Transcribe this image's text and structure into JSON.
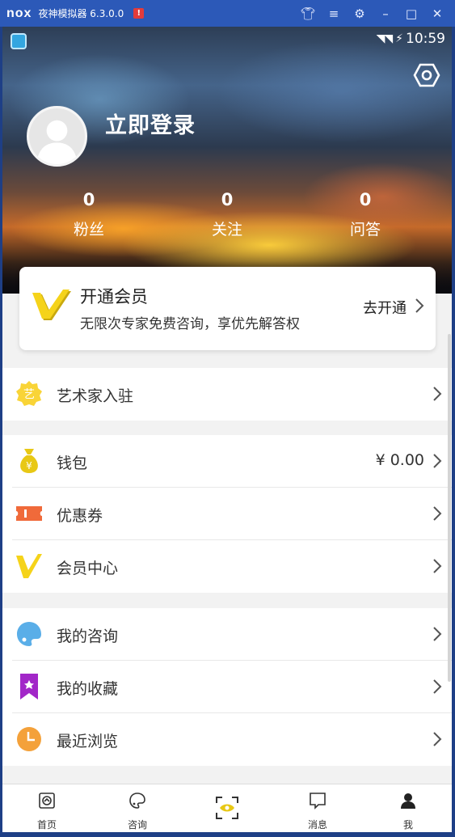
{
  "emulator": {
    "logo": "nox",
    "title": "夜神模拟器 6.3.0.0",
    "alert": "!"
  },
  "status_bar": {
    "time": "10:59"
  },
  "profile": {
    "login_text": "立即登录"
  },
  "stats": [
    {
      "value": "0",
      "label": "粉丝"
    },
    {
      "value": "0",
      "label": "关注"
    },
    {
      "value": "0",
      "label": "问答"
    }
  ],
  "member_card": {
    "title": "开通会员",
    "subtitle": "无限次专家免费咨询，享优先解答权",
    "action": "去开通"
  },
  "groups": [
    {
      "items": [
        {
          "label": "艺术家入驻",
          "icon": "art-badge-icon"
        }
      ]
    },
    {
      "items": [
        {
          "label": "钱包",
          "value": "¥ 0.00",
          "icon": "money-bag-icon"
        },
        {
          "label": "优惠券",
          "icon": "coupon-icon"
        },
        {
          "label": "会员中心",
          "icon": "vip-v-icon"
        }
      ]
    },
    {
      "items": [
        {
          "label": "我的咨询",
          "icon": "palette-icon"
        },
        {
          "label": "我的收藏",
          "icon": "bookmark-icon"
        },
        {
          "label": "最近浏览",
          "icon": "clock-icon"
        }
      ]
    }
  ],
  "tabs": [
    {
      "label": "首页",
      "icon": "home-icon"
    },
    {
      "label": "咨询",
      "icon": "consult-icon"
    },
    {
      "label": "",
      "icon": "scan-icon"
    },
    {
      "label": "消息",
      "icon": "message-icon"
    },
    {
      "label": "我",
      "icon": "profile-icon",
      "active": true
    }
  ],
  "colors": {
    "accent_yellow": "#f5d31a",
    "coupon_red": "#f06a3a",
    "bookmark_purple": "#a227c8",
    "clock_orange": "#f4a13a",
    "palette_blue": "#5aaee8",
    "emulator_blue": "#2c59b8"
  }
}
